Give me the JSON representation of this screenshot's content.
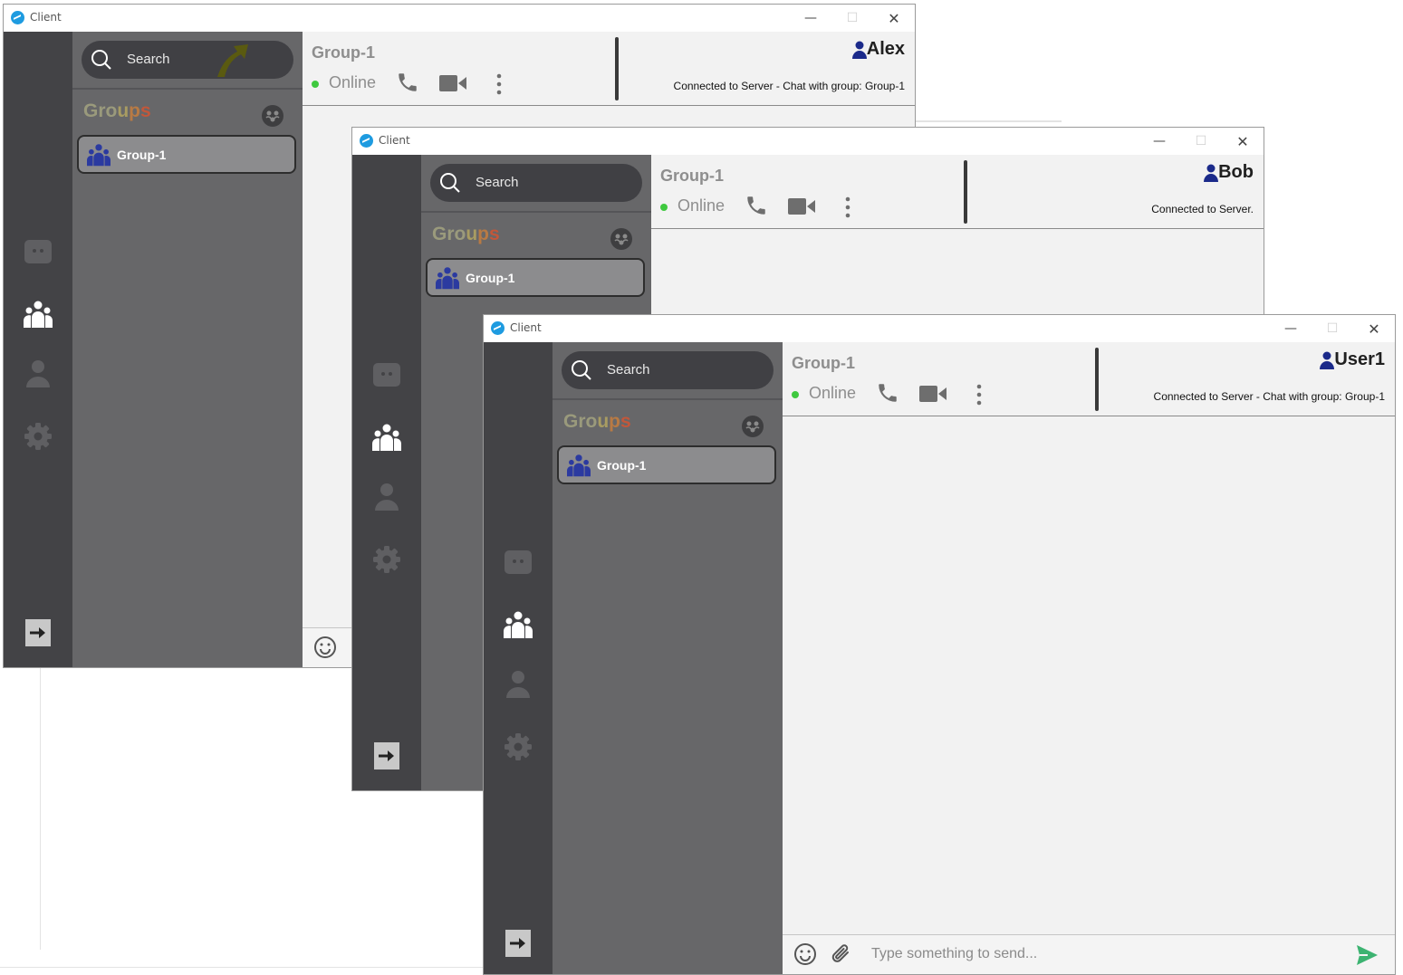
{
  "app": {
    "title": "Client",
    "minimize": "—",
    "maximize": "☐",
    "close": "✕"
  },
  "colors": {
    "rail": "#434346",
    "sidebar": "#676769",
    "selected_group": "#8c8c8e",
    "online": "#3fc93f",
    "user_icon": "#1b2a8a",
    "send": "#3cb371"
  },
  "icons": [
    "chat-bubble-icon",
    "people-icon",
    "person-icon",
    "gear-icon",
    "logout-icon",
    "search-icon",
    "add-group-icon",
    "group-icon",
    "phone-icon",
    "video-icon",
    "more-vertical-icon",
    "user-icon",
    "emoji-icon",
    "attach-icon",
    "send-icon"
  ],
  "windows": [
    {
      "search_placeholder": "Search",
      "groups_title": [
        "Gro",
        "u",
        "p",
        "s"
      ],
      "group_item": "Group-1",
      "chat_title": "Group-1",
      "status": "Online",
      "username": "Alex",
      "connection": "Connected to Server  -  Chat with group: Group-1",
      "composer_placeholder": ""
    },
    {
      "search_placeholder": "Search",
      "groups_title": [
        "Gro",
        "u",
        "p",
        "s"
      ],
      "group_item": "Group-1",
      "chat_title": "Group-1",
      "status": "Online",
      "username": "Bob",
      "connection": "Connected to Server."
    },
    {
      "search_placeholder": "Search",
      "groups_title": [
        "Gro",
        "u",
        "p",
        "s"
      ],
      "group_item": "Group-1",
      "chat_title": "Group-1",
      "status": "Online",
      "username": "User1",
      "connection": "Connected to Server  -  Chat with group: Group-1",
      "composer_placeholder": "Type something to send..."
    }
  ]
}
